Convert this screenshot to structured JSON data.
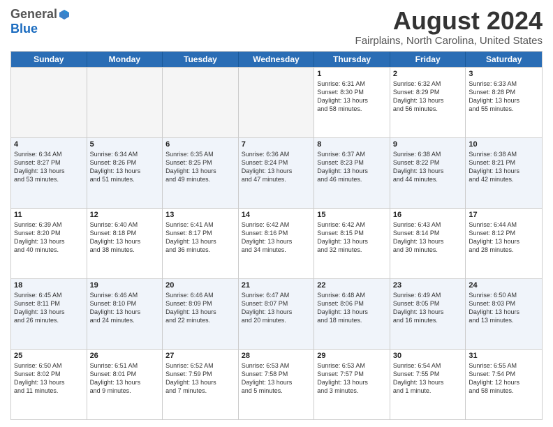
{
  "header": {
    "logo_general": "General",
    "logo_blue": "Blue",
    "main_title": "August 2024",
    "subtitle": "Fairplains, North Carolina, United States"
  },
  "days": [
    "Sunday",
    "Monday",
    "Tuesday",
    "Wednesday",
    "Thursday",
    "Friday",
    "Saturday"
  ],
  "rows": [
    [
      {
        "day": "",
        "text": "",
        "empty": true
      },
      {
        "day": "",
        "text": "",
        "empty": true
      },
      {
        "day": "",
        "text": "",
        "empty": true
      },
      {
        "day": "",
        "text": "",
        "empty": true
      },
      {
        "day": "1",
        "text": "Sunrise: 6:31 AM\nSunset: 8:30 PM\nDaylight: 13 hours\nand 58 minutes.",
        "empty": false
      },
      {
        "day": "2",
        "text": "Sunrise: 6:32 AM\nSunset: 8:29 PM\nDaylight: 13 hours\nand 56 minutes.",
        "empty": false
      },
      {
        "day": "3",
        "text": "Sunrise: 6:33 AM\nSunset: 8:28 PM\nDaylight: 13 hours\nand 55 minutes.",
        "empty": false
      }
    ],
    [
      {
        "day": "4",
        "text": "Sunrise: 6:34 AM\nSunset: 8:27 PM\nDaylight: 13 hours\nand 53 minutes.",
        "empty": false
      },
      {
        "day": "5",
        "text": "Sunrise: 6:34 AM\nSunset: 8:26 PM\nDaylight: 13 hours\nand 51 minutes.",
        "empty": false
      },
      {
        "day": "6",
        "text": "Sunrise: 6:35 AM\nSunset: 8:25 PM\nDaylight: 13 hours\nand 49 minutes.",
        "empty": false
      },
      {
        "day": "7",
        "text": "Sunrise: 6:36 AM\nSunset: 8:24 PM\nDaylight: 13 hours\nand 47 minutes.",
        "empty": false
      },
      {
        "day": "8",
        "text": "Sunrise: 6:37 AM\nSunset: 8:23 PM\nDaylight: 13 hours\nand 46 minutes.",
        "empty": false
      },
      {
        "day": "9",
        "text": "Sunrise: 6:38 AM\nSunset: 8:22 PM\nDaylight: 13 hours\nand 44 minutes.",
        "empty": false
      },
      {
        "day": "10",
        "text": "Sunrise: 6:38 AM\nSunset: 8:21 PM\nDaylight: 13 hours\nand 42 minutes.",
        "empty": false
      }
    ],
    [
      {
        "day": "11",
        "text": "Sunrise: 6:39 AM\nSunset: 8:20 PM\nDaylight: 13 hours\nand 40 minutes.",
        "empty": false
      },
      {
        "day": "12",
        "text": "Sunrise: 6:40 AM\nSunset: 8:18 PM\nDaylight: 13 hours\nand 38 minutes.",
        "empty": false
      },
      {
        "day": "13",
        "text": "Sunrise: 6:41 AM\nSunset: 8:17 PM\nDaylight: 13 hours\nand 36 minutes.",
        "empty": false
      },
      {
        "day": "14",
        "text": "Sunrise: 6:42 AM\nSunset: 8:16 PM\nDaylight: 13 hours\nand 34 minutes.",
        "empty": false
      },
      {
        "day": "15",
        "text": "Sunrise: 6:42 AM\nSunset: 8:15 PM\nDaylight: 13 hours\nand 32 minutes.",
        "empty": false
      },
      {
        "day": "16",
        "text": "Sunrise: 6:43 AM\nSunset: 8:14 PM\nDaylight: 13 hours\nand 30 minutes.",
        "empty": false
      },
      {
        "day": "17",
        "text": "Sunrise: 6:44 AM\nSunset: 8:12 PM\nDaylight: 13 hours\nand 28 minutes.",
        "empty": false
      }
    ],
    [
      {
        "day": "18",
        "text": "Sunrise: 6:45 AM\nSunset: 8:11 PM\nDaylight: 13 hours\nand 26 minutes.",
        "empty": false
      },
      {
        "day": "19",
        "text": "Sunrise: 6:46 AM\nSunset: 8:10 PM\nDaylight: 13 hours\nand 24 minutes.",
        "empty": false
      },
      {
        "day": "20",
        "text": "Sunrise: 6:46 AM\nSunset: 8:09 PM\nDaylight: 13 hours\nand 22 minutes.",
        "empty": false
      },
      {
        "day": "21",
        "text": "Sunrise: 6:47 AM\nSunset: 8:07 PM\nDaylight: 13 hours\nand 20 minutes.",
        "empty": false
      },
      {
        "day": "22",
        "text": "Sunrise: 6:48 AM\nSunset: 8:06 PM\nDaylight: 13 hours\nand 18 minutes.",
        "empty": false
      },
      {
        "day": "23",
        "text": "Sunrise: 6:49 AM\nSunset: 8:05 PM\nDaylight: 13 hours\nand 16 minutes.",
        "empty": false
      },
      {
        "day": "24",
        "text": "Sunrise: 6:50 AM\nSunset: 8:03 PM\nDaylight: 13 hours\nand 13 minutes.",
        "empty": false
      }
    ],
    [
      {
        "day": "25",
        "text": "Sunrise: 6:50 AM\nSunset: 8:02 PM\nDaylight: 13 hours\nand 11 minutes.",
        "empty": false
      },
      {
        "day": "26",
        "text": "Sunrise: 6:51 AM\nSunset: 8:01 PM\nDaylight: 13 hours\nand 9 minutes.",
        "empty": false
      },
      {
        "day": "27",
        "text": "Sunrise: 6:52 AM\nSunset: 7:59 PM\nDaylight: 13 hours\nand 7 minutes.",
        "empty": false
      },
      {
        "day": "28",
        "text": "Sunrise: 6:53 AM\nSunset: 7:58 PM\nDaylight: 13 hours\nand 5 minutes.",
        "empty": false
      },
      {
        "day": "29",
        "text": "Sunrise: 6:53 AM\nSunset: 7:57 PM\nDaylight: 13 hours\nand 3 minutes.",
        "empty": false
      },
      {
        "day": "30",
        "text": "Sunrise: 6:54 AM\nSunset: 7:55 PM\nDaylight: 13 hours\nand 1 minute.",
        "empty": false
      },
      {
        "day": "31",
        "text": "Sunrise: 6:55 AM\nSunset: 7:54 PM\nDaylight: 12 hours\nand 58 minutes.",
        "empty": false
      }
    ]
  ]
}
